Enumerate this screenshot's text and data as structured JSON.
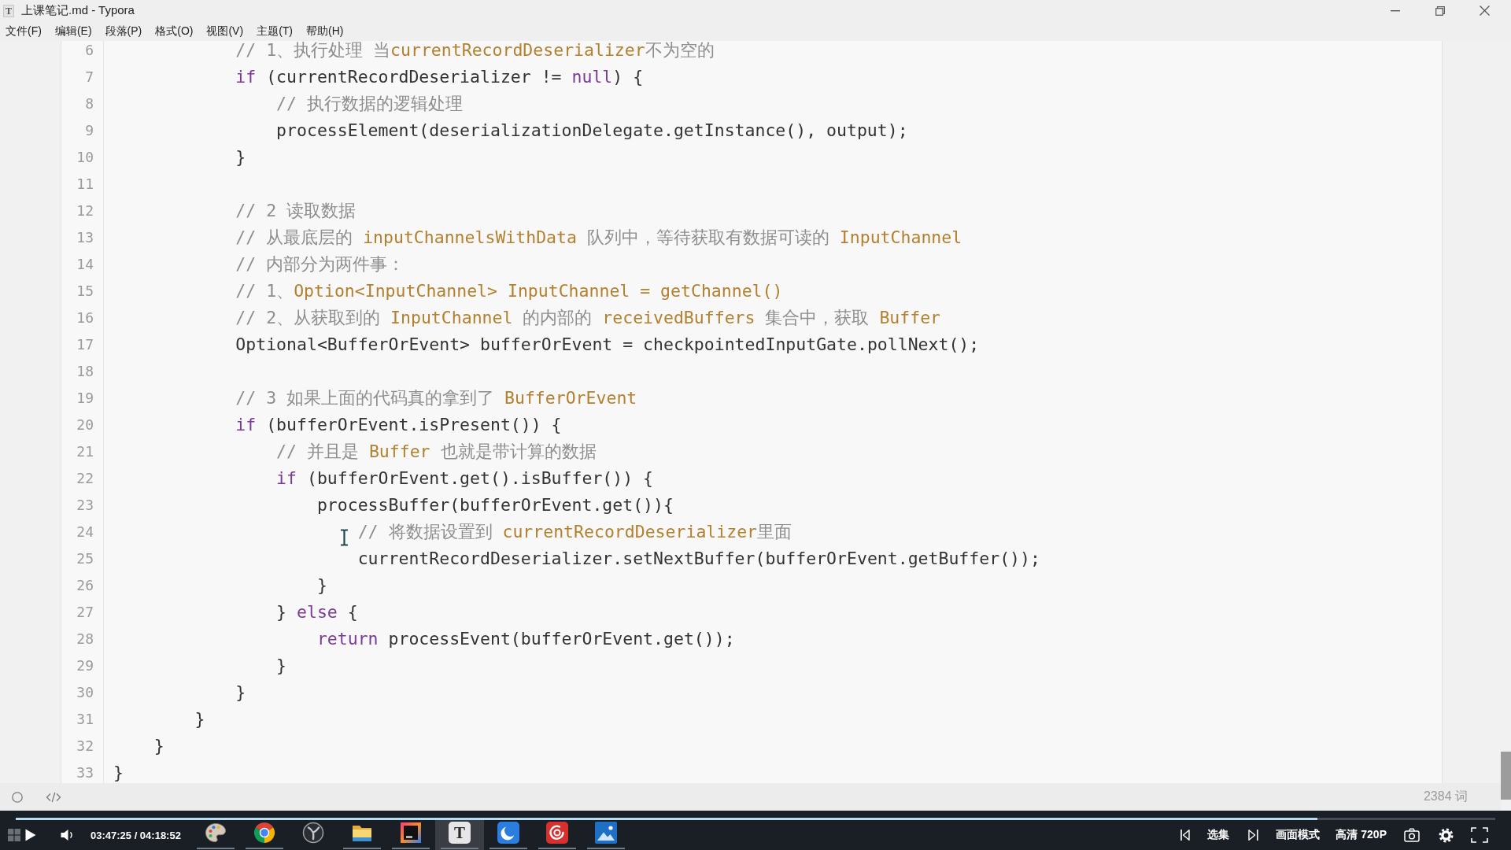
{
  "window": {
    "icon_letter": "T",
    "title": "上课笔记.md - Typora"
  },
  "menu": [
    "文件(F)",
    "编辑(E)",
    "段落(P)",
    "格式(O)",
    "视图(V)",
    "主题(T)",
    "帮助(H)"
  ],
  "code_block": {
    "lines": [
      {
        "number": "6",
        "tokens": [
          {
            "kind": "comment",
            "text": "            // 1、执行处理 当"
          },
          {
            "kind": "term",
            "text": "currentRecordDeserializer"
          },
          {
            "kind": "comment",
            "text": "不为空的"
          }
        ]
      },
      {
        "number": "7",
        "tokens": [
          {
            "kind": "keyword",
            "text": "            if"
          },
          {
            "kind": "plain",
            "text": " (currentRecordDeserializer != "
          },
          {
            "kind": "keyword",
            "text": "null"
          },
          {
            "kind": "plain",
            "text": ") {"
          }
        ]
      },
      {
        "number": "8",
        "tokens": [
          {
            "kind": "comment",
            "text": "                // 执行数据的逻辑处理"
          }
        ]
      },
      {
        "number": "9",
        "tokens": [
          {
            "kind": "plain",
            "text": "                processElement(deserializationDelegate.getInstance(), output);"
          }
        ]
      },
      {
        "number": "10",
        "tokens": [
          {
            "kind": "plain",
            "text": "            }"
          }
        ]
      },
      {
        "number": "11"
      },
      {
        "number": "12",
        "tokens": [
          {
            "kind": "comment",
            "text": "            // 2 读取数据"
          }
        ]
      },
      {
        "number": "13",
        "tokens": [
          {
            "kind": "comment",
            "text": "            // 从最底层的 "
          },
          {
            "kind": "term",
            "text": "inputChannelsWithData"
          },
          {
            "kind": "comment",
            "text": " 队列中，等待获取有数据可读的 "
          },
          {
            "kind": "term",
            "text": "InputChannel"
          }
        ]
      },
      {
        "number": "14",
        "tokens": [
          {
            "kind": "comment",
            "text": "            // 内部分为两件事："
          }
        ]
      },
      {
        "number": "15",
        "tokens": [
          {
            "kind": "comment",
            "text": "            // 1、"
          },
          {
            "kind": "term",
            "text": "Option<InputChannel> InputChannel = getChannel()"
          }
        ]
      },
      {
        "number": "16",
        "tokens": [
          {
            "kind": "comment",
            "text": "            // 2、从获取到的 "
          },
          {
            "kind": "term",
            "text": "InputChannel"
          },
          {
            "kind": "comment",
            "text": " 的内部的 "
          },
          {
            "kind": "term",
            "text": "receivedBuffers"
          },
          {
            "kind": "comment",
            "text": " 集合中，获取 "
          },
          {
            "kind": "term",
            "text": "Buffer"
          }
        ]
      },
      {
        "number": "17",
        "tokens": [
          {
            "kind": "plain",
            "text": "            Optional<BufferOrEvent> bufferOrEvent = checkpointedInputGate.pollNext();"
          }
        ]
      },
      {
        "number": "18"
      },
      {
        "number": "19",
        "tokens": [
          {
            "kind": "comment",
            "text": "            // 3 如果上面的代码真的拿到了 "
          },
          {
            "kind": "term",
            "text": "BufferOrEvent"
          }
        ]
      },
      {
        "number": "20",
        "tokens": [
          {
            "kind": "keyword",
            "text": "            if"
          },
          {
            "kind": "plain",
            "text": " (bufferOrEvent.isPresent()) {"
          }
        ]
      },
      {
        "number": "21",
        "tokens": [
          {
            "kind": "comment",
            "text": "                // 并且是 "
          },
          {
            "kind": "term",
            "text": "Buffer"
          },
          {
            "kind": "comment",
            "text": " 也就是带计算的数据"
          }
        ]
      },
      {
        "number": "22",
        "tokens": [
          {
            "kind": "keyword",
            "text": "                if"
          },
          {
            "kind": "plain",
            "text": " (bufferOrEvent.get().isBuffer()) {"
          }
        ]
      },
      {
        "number": "23",
        "tokens": [
          {
            "kind": "plain",
            "text": "                    processBuffer(bufferOrEvent.get()){"
          }
        ]
      },
      {
        "number": "24",
        "tokens": [
          {
            "kind": "comment",
            "text": "                        // 将数据设置到 "
          },
          {
            "kind": "term",
            "text": "currentRecordDeserializer"
          },
          {
            "kind": "comment",
            "text": "里面"
          }
        ]
      },
      {
        "number": "25",
        "tokens": [
          {
            "kind": "plain",
            "text": "                        currentRecordDeserializer.setNextBuffer(bufferOrEvent.getBuffer());"
          }
        ]
      },
      {
        "number": "26",
        "tokens": [
          {
            "kind": "plain",
            "text": "                    }"
          }
        ]
      },
      {
        "number": "27",
        "tokens": [
          {
            "kind": "plain",
            "text": "                } "
          },
          {
            "kind": "keyword",
            "text": "else"
          },
          {
            "kind": "plain",
            "text": " {"
          }
        ]
      },
      {
        "number": "28",
        "tokens": [
          {
            "kind": "keyword",
            "text": "                    return"
          },
          {
            "kind": "plain",
            "text": " processEvent(bufferOrEvent.get());"
          }
        ]
      },
      {
        "number": "29",
        "tokens": [
          {
            "kind": "plain",
            "text": "                }"
          }
        ]
      },
      {
        "number": "30",
        "tokens": [
          {
            "kind": "plain",
            "text": "            }"
          }
        ]
      },
      {
        "number": "31",
        "tokens": [
          {
            "kind": "plain",
            "text": "        }"
          }
        ]
      },
      {
        "number": "32",
        "tokens": [
          {
            "kind": "plain",
            "text": "    }"
          }
        ]
      },
      {
        "number": "33",
        "tokens": [
          {
            "kind": "plain",
            "text": "}"
          }
        ]
      }
    ]
  },
  "status_bar": {
    "word_count": "2384 词"
  },
  "player": {
    "progress": {
      "level": 0.88
    },
    "time": "03:47:25 / 04:18:52",
    "episodes": "选集",
    "picture_mode": "画面模式",
    "quality": "高清 720P"
  },
  "taskbar": {
    "apps": [
      {
        "kind": "palette",
        "running": true,
        "selected": false
      },
      {
        "kind": "wheel",
        "running": true,
        "selected": false
      },
      {
        "kind": "emblem",
        "running": false,
        "selected": false
      },
      {
        "kind": "folder",
        "running": true,
        "selected": false
      },
      {
        "kind": "ide",
        "running": true,
        "selected": false
      },
      {
        "kind": "letter",
        "letter": "T",
        "running": true,
        "selected": true
      },
      {
        "kind": "crescent",
        "running": true,
        "selected": false
      },
      {
        "kind": "swirl",
        "running": true,
        "selected": false
      },
      {
        "kind": "picture",
        "running": true,
        "selected": false
      }
    ]
  }
}
